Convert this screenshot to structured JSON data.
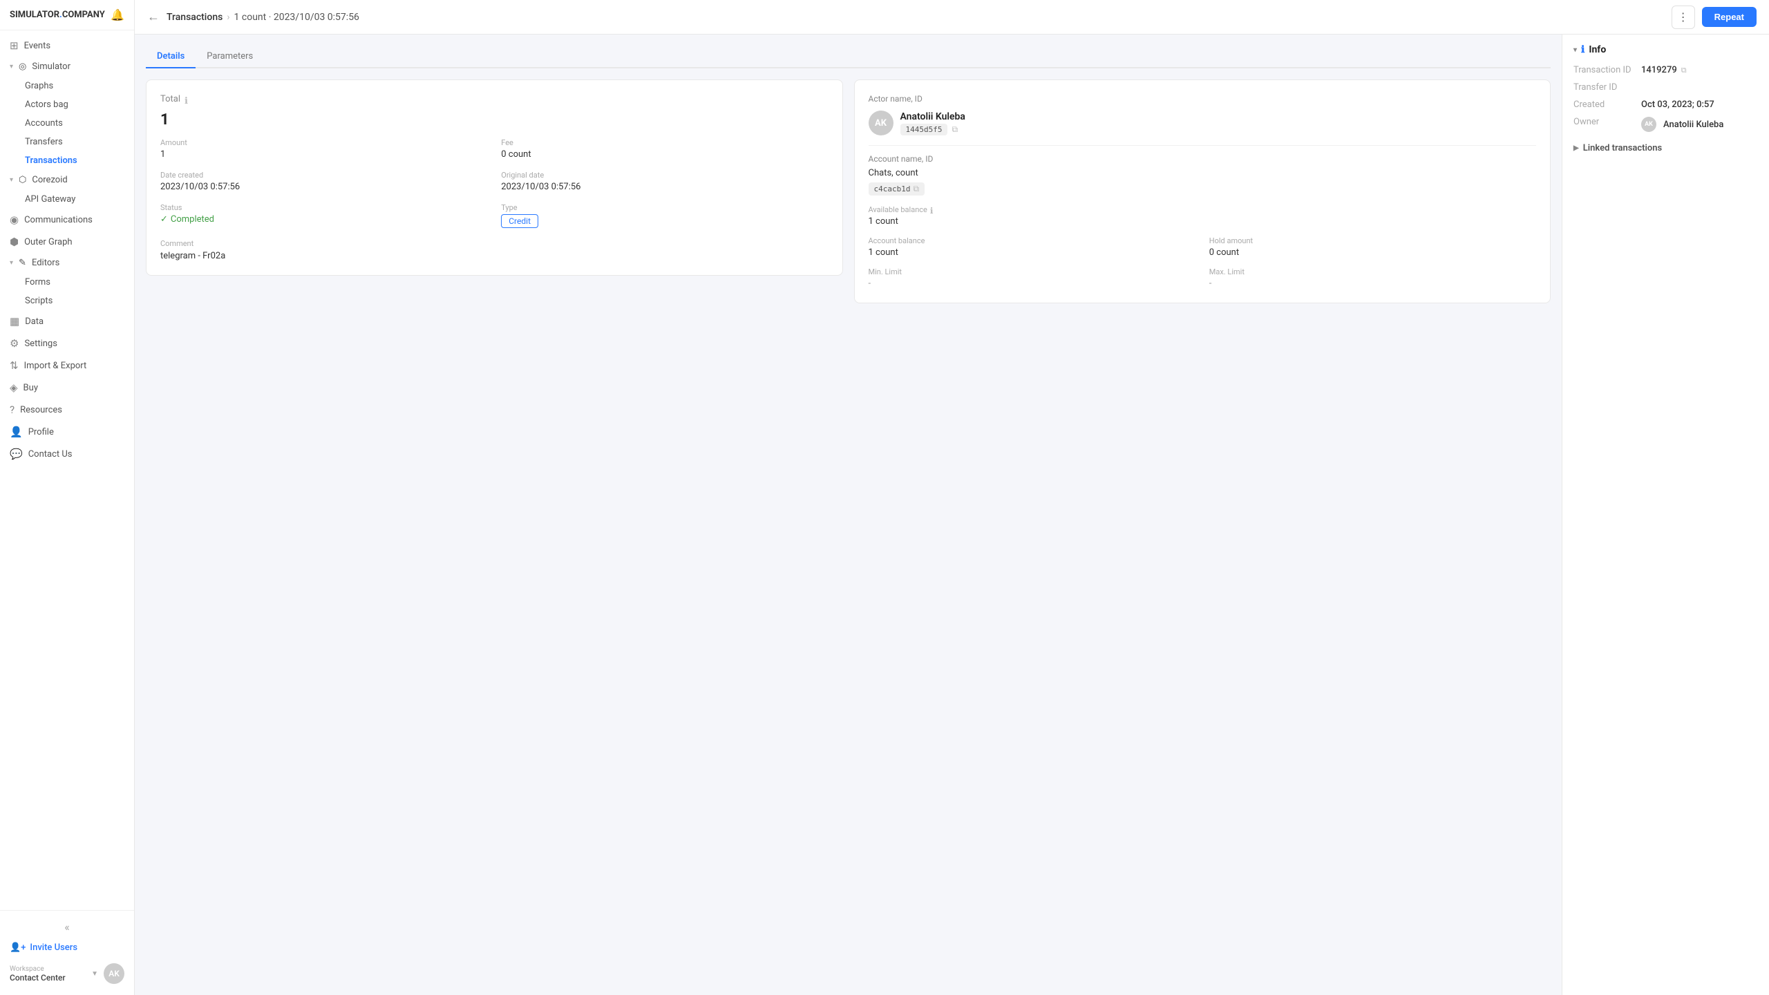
{
  "logo": {
    "prefix": "SIMULATOR",
    "dot": ".",
    "suffix": "COMPANY"
  },
  "sidebar": {
    "items": [
      {
        "id": "events",
        "label": "Events",
        "icon": "⊞"
      },
      {
        "id": "simulator",
        "label": "Simulator",
        "icon": "◎",
        "expanded": true
      },
      {
        "id": "graphs",
        "label": "Graphs",
        "indent": true
      },
      {
        "id": "actors-bag",
        "label": "Actors bag",
        "indent": true
      },
      {
        "id": "accounts",
        "label": "Accounts",
        "indent": true
      },
      {
        "id": "transfers",
        "label": "Transfers",
        "indent": true
      },
      {
        "id": "transactions",
        "label": "Transactions",
        "indent": true,
        "active": true
      },
      {
        "id": "corezoid",
        "label": "Corezoid",
        "icon": "⬡",
        "expanded": true
      },
      {
        "id": "api-gateway",
        "label": "API Gateway",
        "indent": true
      },
      {
        "id": "communications",
        "label": "Communications",
        "icon": "◉"
      },
      {
        "id": "outer-graph",
        "label": "Outer Graph",
        "icon": "⬢"
      },
      {
        "id": "editors",
        "label": "Editors",
        "icon": "✎",
        "expanded": true
      },
      {
        "id": "forms",
        "label": "Forms",
        "indent": true
      },
      {
        "id": "scripts",
        "label": "Scripts",
        "indent": true
      },
      {
        "id": "data",
        "label": "Data",
        "icon": "▦"
      },
      {
        "id": "settings",
        "label": "Settings",
        "icon": "⚙"
      },
      {
        "id": "import-export",
        "label": "Import & Export",
        "icon": "⇅"
      },
      {
        "id": "buy",
        "label": "Buy",
        "icon": "◈"
      },
      {
        "id": "resources",
        "label": "Resources",
        "icon": "?"
      },
      {
        "id": "profile",
        "label": "Profile",
        "icon": "👤"
      },
      {
        "id": "contact-us",
        "label": "Contact Us",
        "icon": "💬"
      }
    ],
    "invite_label": "Invite Users",
    "collapse_icon": "«",
    "workspace_label": "Workspace",
    "workspace_name": "Contact Center",
    "workspace_chevron": "▼"
  },
  "topbar": {
    "back_icon": "←",
    "breadcrumb_link": "Transactions",
    "breadcrumb_sep": "›",
    "breadcrumb_current": "1 count · 2023/10/03 0:57:56",
    "more_icon": "⋮",
    "repeat_label": "Repeat"
  },
  "tabs": [
    {
      "id": "details",
      "label": "Details",
      "active": true
    },
    {
      "id": "parameters",
      "label": "Parameters"
    }
  ],
  "left_card": {
    "total_label": "Total",
    "total_info_icon": "ℹ",
    "total_value": "1",
    "fields": [
      {
        "label": "Amount",
        "value": "1"
      },
      {
        "label": "Fee",
        "value": "0 count"
      },
      {
        "label": "Date created",
        "value": "2023/10/03 0:57:56"
      },
      {
        "label": "Original date",
        "value": "2023/10/03 0:57:56"
      },
      {
        "label": "Status",
        "value": "Completed",
        "type": "status"
      },
      {
        "label": "Type",
        "value": "Credit",
        "type": "badge"
      }
    ],
    "comment_label": "Comment",
    "comment_value": "telegram - Fr02a"
  },
  "right_card": {
    "actor_name_id_label": "Actor name, ID",
    "actor_name": "Anatolii Kuleba",
    "actor_id": "1445d5f5",
    "account_name_id_label": "Account name, ID",
    "account_name": "Chats, count",
    "account_id": "c4cacb1d",
    "available_balance_label": "Available balance",
    "available_balance_info": "ℹ",
    "available_balance_value": "1 count",
    "account_balance_label": "Account balance",
    "account_balance_value": "1 count",
    "hold_amount_label": "Hold amount",
    "hold_amount_value": "0 count",
    "min_limit_label": "Min. Limit",
    "min_limit_value": "-",
    "max_limit_label": "Max. Limit",
    "max_limit_value": "-"
  },
  "info_panel": {
    "title": "Info",
    "info_icon": "ℹ",
    "transaction_id_label": "Transaction ID",
    "transaction_id_value": "1419279",
    "transfer_id_label": "Transfer ID",
    "transfer_id_value": "",
    "created_label": "Created",
    "created_value": "Oct 03, 2023; 0:57",
    "owner_label": "Owner",
    "owner_value": "Anatolii Kuleba",
    "linked_label": "Linked transactions"
  }
}
